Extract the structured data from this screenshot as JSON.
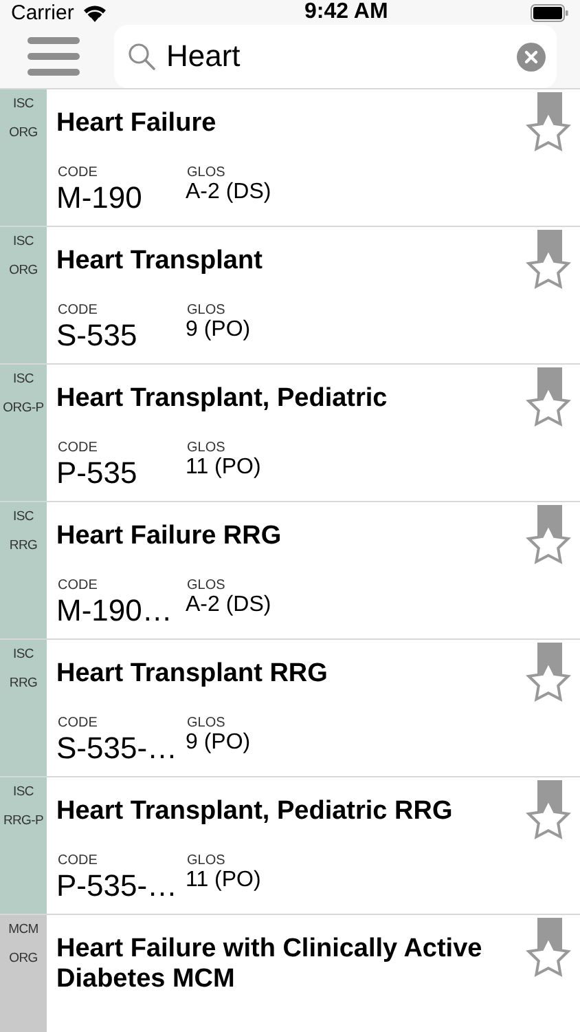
{
  "status_bar": {
    "carrier": "Carrier",
    "time": "9:42 AM"
  },
  "search": {
    "value": "Heart"
  },
  "results": [
    {
      "tags": [
        "ISC",
        "ORG"
      ],
      "color": "#b5cdc4",
      "title": "Heart Failure",
      "code_label": "CODE",
      "code": "M-190",
      "glos_label": "GLOS",
      "glos": "A-2 (DS)"
    },
    {
      "tags": [
        "ISC",
        "ORG"
      ],
      "color": "#b5cdc4",
      "title": "Heart Transplant",
      "code_label": "CODE",
      "code": "S-535",
      "glos_label": "GLOS",
      "glos": "9 (PO)"
    },
    {
      "tags": [
        "ISC",
        "ORG-P"
      ],
      "color": "#b5cdc4",
      "title": "Heart Transplant, Pediatric",
      "code_label": "CODE",
      "code": "P-535",
      "glos_label": "GLOS",
      "glos": "11 (PO)"
    },
    {
      "tags": [
        "ISC",
        "RRG"
      ],
      "color": "#b5cdc4",
      "title": "Heart Failure RRG",
      "code_label": "CODE",
      "code": "M-190…",
      "glos_label": "GLOS",
      "glos": "A-2 (DS)"
    },
    {
      "tags": [
        "ISC",
        "RRG"
      ],
      "color": "#b5cdc4",
      "title": "Heart Transplant RRG",
      "code_label": "CODE",
      "code": "S-535-…",
      "glos_label": "GLOS",
      "glos": "9 (PO)"
    },
    {
      "tags": [
        "ISC",
        "RRG-P"
      ],
      "color": "#b5cdc4",
      "title": "Heart Transplant, Pediatric RRG",
      "code_label": "CODE",
      "code": "P-535-…",
      "glos_label": "GLOS",
      "glos": "11 (PO)"
    },
    {
      "tags": [
        "MCM",
        "ORG"
      ],
      "color": "#c9c9c9",
      "title": "Heart Failure with Clinically Active Diabetes MCM"
    }
  ]
}
